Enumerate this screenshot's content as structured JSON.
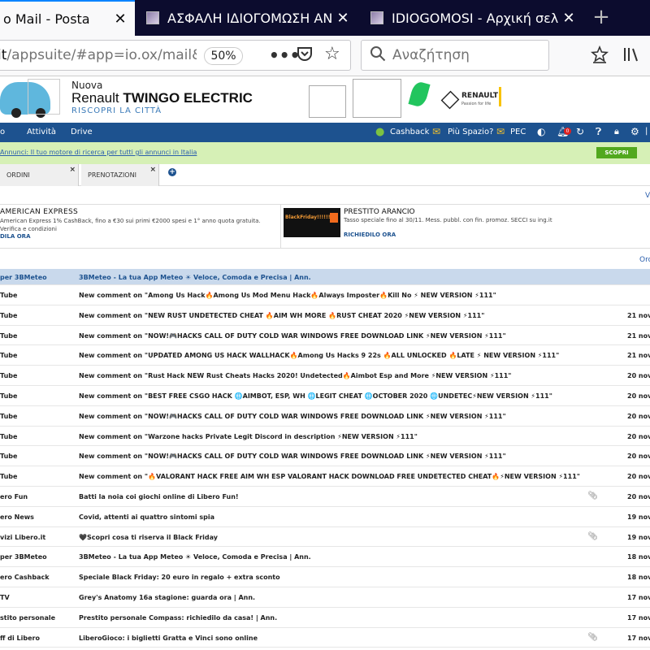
{
  "tabs": [
    {
      "title": "o Mail - Posta",
      "active": true
    },
    {
      "title": "ΑΣΦΑΛΗ ΙΔΙΟΓΟΜΩΣΗ ΑΝΩΤ",
      "active": false
    },
    {
      "title": "IDIOGOMOSI - Αρχική σελίδα",
      "active": false
    }
  ],
  "new_tab_label": "+",
  "url": {
    "prefix": "it",
    "path": "/appsuite/#app=io.ox/mail&fo",
    "zoom": "50%"
  },
  "search": {
    "placeholder": "Αναζήτηση"
  },
  "ad": {
    "line1": "Nuova",
    "line2_brand": "Renault",
    "line2_model": "TWINGO ELECTRIC",
    "line3": "RISCOPRI LA CITTÀ",
    "logo": "RENAULT",
    "logo_tag": "Passion for life"
  },
  "appbar": {
    "items": [
      "o",
      "Attività",
      "Drive"
    ],
    "cashback": "Cashback",
    "space": "Più Spazio?",
    "pec": "PEC",
    "notif_count": "0"
  },
  "promo": {
    "text": "Annunci: Il tuo motore di ricerca per tutti gli annunci in Italia",
    "button": "SCOPRI"
  },
  "subtabs": [
    {
      "label": "ORDINI",
      "close": "×"
    },
    {
      "label": "PRENOTAZIONI",
      "close": "×"
    }
  ],
  "plus_label": "+",
  "partial_right_top": "V",
  "partial_right_sort": "Ord",
  "ad_cards": [
    {
      "title": "AMERICAN EXPRESS",
      "desc": "American Express 1% CashBack, fino a €30 sui primi €2000 spesi e 1° anno quota gratuita. Verifica e condizioni",
      "link": "DILA ORA"
    },
    {
      "thumb_text": "BlackFriday!!!!!!!",
      "title": "PRESTITO ARANCIO",
      "desc": "Tasso speciale fino al 30/11. Mess. pubbl. con fin. promoz. SECCI su ing.it",
      "link": "RICHIEDILO ORA"
    }
  ],
  "mails": [
    {
      "from": "per 3BMeteo",
      "subject": "3BMeteo - La tua App Meteo ☀ Veloce, Comoda e Precisa | Ann.",
      "date": "",
      "clip": false,
      "selected": true
    },
    {
      "from": "Tube",
      "subject": "New comment on \"Among Us Hack🔥Among Us Mod Menu Hack🔥Always Imposter🔥Kill No ⚡ NEW VERSION ⚡111\"",
      "date": "",
      "clip": false
    },
    {
      "from": "Tube",
      "subject": "New comment on \"NEW RUST UNDETECTED CHEAT 🔥AIM WH MORE 🔥RUST CHEAT 2020 ⚡NEW VERSION ⚡111\"",
      "date": "21 nov",
      "clip": false
    },
    {
      "from": "Tube",
      "subject": "New comment on \"NOW!🎮HACKS CALL OF DUTY COLD WAR WINDOWS FREE DOWNLOAD LINK ⚡NEW VERSION ⚡111\"",
      "date": "21 nov",
      "clip": false
    },
    {
      "from": "Tube",
      "subject": "New comment on \"UPDATED AMONG US HACK WALLHACK🔥Among Us Hacks 9 22s 🔥ALL UNLOCKED 🔥LATE ⚡ NEW VERSION ⚡111\"",
      "date": "21 nov",
      "clip": false
    },
    {
      "from": "Tube",
      "subject": "New comment on \"Rust Hack NEW Rust Cheats Hacks 2020! Undetected🔥Aimbot Esp and More ⚡NEW VERSION ⚡111\"",
      "date": "20 nov",
      "clip": false
    },
    {
      "from": "Tube",
      "subject": "New comment on \"BEST FREE CSGO HACK 🌐AIMBOT, ESP, WH 🌐LEGIT CHEAT 🌐OCTOBER 2020 🌐UNDETEC⚡NEW VERSION ⚡111\"",
      "date": "20 nov",
      "clip": false
    },
    {
      "from": "Tube",
      "subject": "New comment on \"NOW!🎮HACKS CALL OF DUTY COLD WAR WINDOWS FREE DOWNLOAD LINK ⚡NEW VERSION ⚡111\"",
      "date": "20 nov",
      "clip": false
    },
    {
      "from": "Tube",
      "subject": "New comment on \"Warzone hacks Private Legit Discord in description ⚡NEW VERSION ⚡111\"",
      "date": "20 nov",
      "clip": false
    },
    {
      "from": "Tube",
      "subject": "New comment on \"NOW!🎮HACKS CALL OF DUTY COLD WAR WINDOWS FREE DOWNLOAD LINK ⚡NEW VERSION ⚡111\"",
      "date": "20 nov",
      "clip": false
    },
    {
      "from": "Tube",
      "subject": "New comment on \"🔥VALORANT HACK FREE AIM WH ESP VALORANT HACK DOWNLOAD FREE UNDETECTED CHEAT🔥⚡NEW VERSION ⚡111\"",
      "date": "20 nov",
      "clip": false
    },
    {
      "from": "ero Fun",
      "subject": "Batti la noia coi giochi online di Libero Fun!",
      "date": "20 nov",
      "clip": true
    },
    {
      "from": "ero News",
      "subject": "Covid, attenti ai quattro sintomi spia",
      "date": "19 nov",
      "clip": false
    },
    {
      "from": "vizi Libero.it",
      "subject": "🖤Scopri cosa ti riserva il Black Friday",
      "date": "19 nov",
      "clip": true
    },
    {
      "from": "per 3BMeteo",
      "subject": "3BMeteo - La tua App Meteo ☀ Veloce, Comoda e Precisa | Ann.",
      "date": "18 nov",
      "clip": false
    },
    {
      "from": "ero Cashback",
      "subject": "Speciale Black Friday: 20 euro in regalo + extra sconto",
      "date": "18 nov",
      "clip": false
    },
    {
      "from": "TV",
      "subject": "Grey's Anatomy 16a stagione: guarda ora | Ann.",
      "date": "17 nov",
      "clip": false
    },
    {
      "from": "stito personale",
      "subject": "Prestito personale Compass: richiedilo da casa! | Ann.",
      "date": "17 nov",
      "clip": false
    },
    {
      "from": "ff di Libero",
      "subject": "LiberoGioco: i biglietti Gratta e Vinci sono online",
      "date": "17 nov",
      "clip": true
    }
  ]
}
